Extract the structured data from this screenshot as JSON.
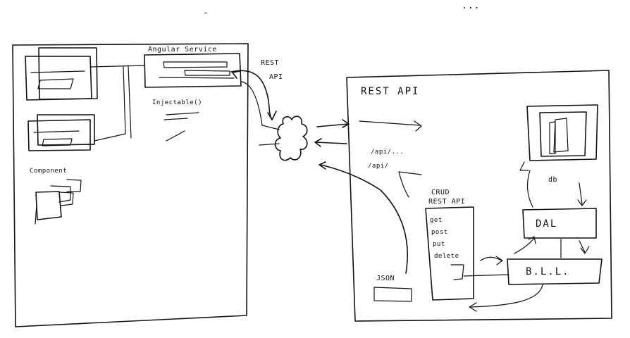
{
  "top_marks": {
    "left": "-",
    "right": "..."
  },
  "frontend": {
    "service_title": "Angular Service",
    "injectable": "Injectable()",
    "component_label": "Component"
  },
  "rest_arrow_label": {
    "line1": "REST",
    "line2": "API"
  },
  "backend": {
    "title": "REST API",
    "endpoint_1": "/api/...",
    "endpoint_2": "/api/",
    "crud_title": {
      "line1": "CRUD",
      "line2": "REST API"
    },
    "methods": [
      "get",
      "post",
      "put",
      "delete"
    ],
    "json_label": "JSON",
    "db_label": "db",
    "dal_label": "DAL",
    "bll_label": "B.L.L."
  }
}
